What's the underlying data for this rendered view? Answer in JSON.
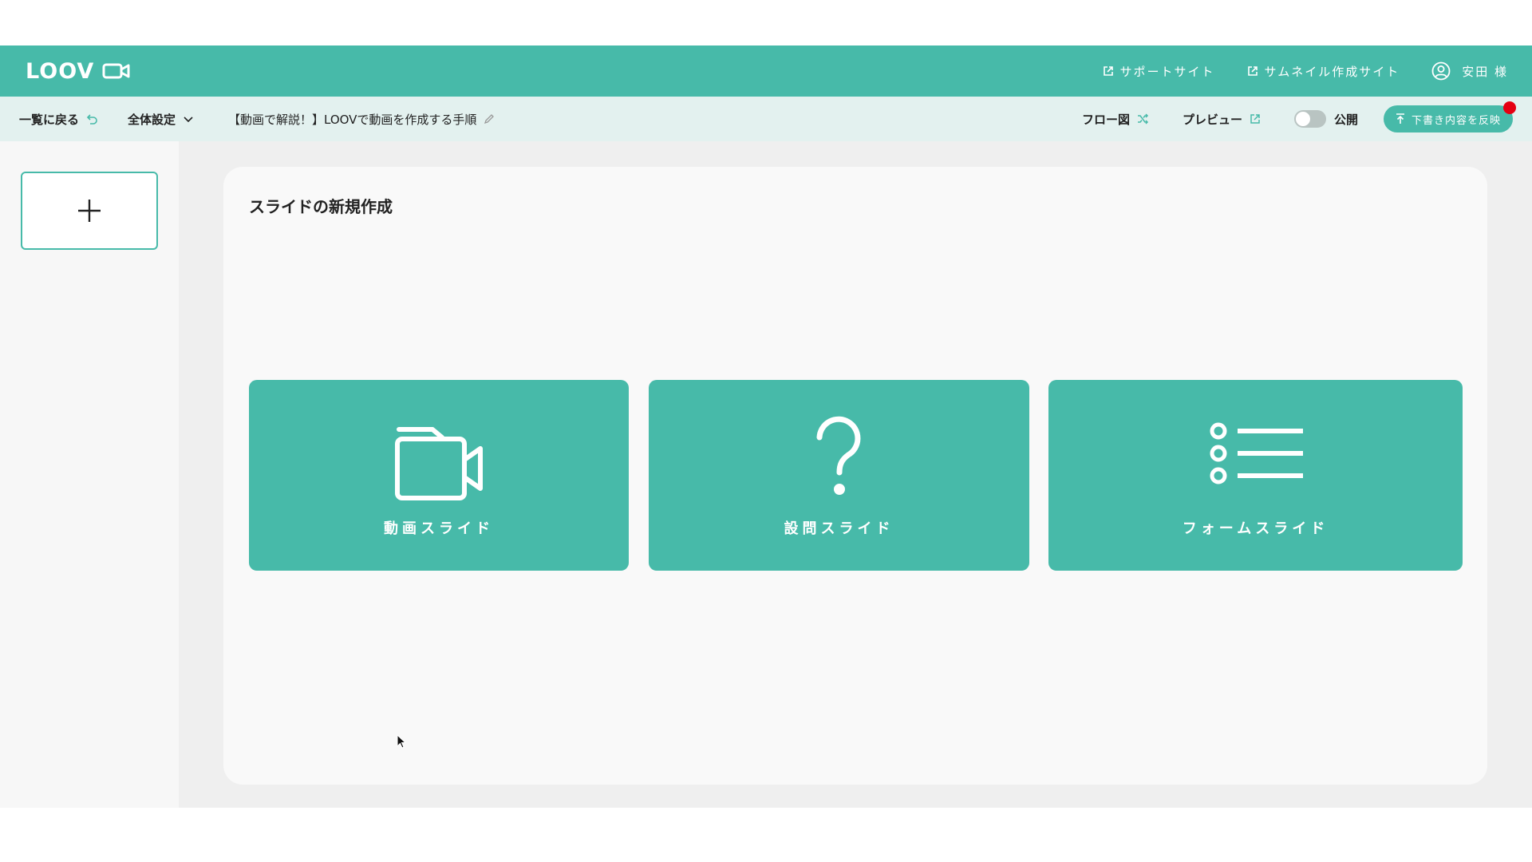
{
  "header": {
    "logo": "LOOV",
    "links": [
      {
        "label": "サポートサイト"
      },
      {
        "label": "サムネイル作成サイト"
      }
    ],
    "user": "安田 様"
  },
  "toolbar": {
    "back_label": "一覧に戻る",
    "settings_label": "全体設定",
    "doc_title": "【動画で解説！】LOOVで動画を作成する手順",
    "flow_label": "フロー図",
    "preview_label": "プレビュー",
    "public_label": "公開",
    "public_on": false,
    "publish_button": "下書き内容を反映"
  },
  "main": {
    "title": "スライドの新規作成",
    "cards": [
      {
        "label": "動画スライド",
        "icon": "video-camera-icon"
      },
      {
        "label": "設問スライド",
        "icon": "question-mark-icon"
      },
      {
        "label": "フォームスライド",
        "icon": "list-icon"
      }
    ]
  },
  "colors": {
    "accent": "#47baa9",
    "toolbar_bg": "#e3f1ef",
    "notification": "#e50012"
  }
}
